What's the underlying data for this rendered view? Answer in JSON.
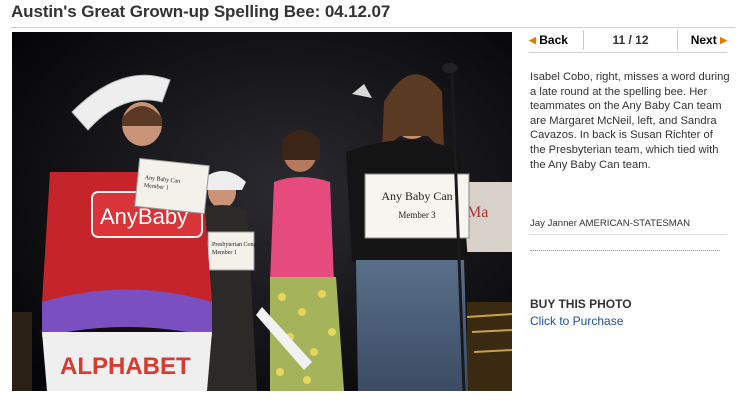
{
  "page": {
    "title": "Austin's Great Grown-up Spelling Bee: 04.12.07"
  },
  "nav": {
    "back_label": "Back",
    "next_label": "Next",
    "counter": "11 / 12",
    "current": 11,
    "total": 12
  },
  "photo": {
    "signs": {
      "can_text": "AnyBaby",
      "card_left": "Any Baby Can\nMember 1",
      "card_middle": "Presbyterian Congregation Members\nMember 1",
      "card_right": "Any Baby Can",
      "card_right_sub": "Member 3",
      "alphabet": "ALPHABET"
    }
  },
  "caption": {
    "text": "Isabel Cobo, right, misses a word during a late round at the spelling bee. Her teammates on the Any Baby Can team are Margaret McNeil, left, and Sandra Cavazos. In back is Susan Richter of the Presbyterian team, which tied with the Any Baby Can team.",
    "credit": "Jay Janner AMERICAN-STATESMAN"
  },
  "buy": {
    "title": "BUY THIS PHOTO",
    "link": "Click to Purchase"
  },
  "colors": {
    "accent_arrow": "#e07a00",
    "link": "#1a4fa0",
    "text": "#333333"
  }
}
